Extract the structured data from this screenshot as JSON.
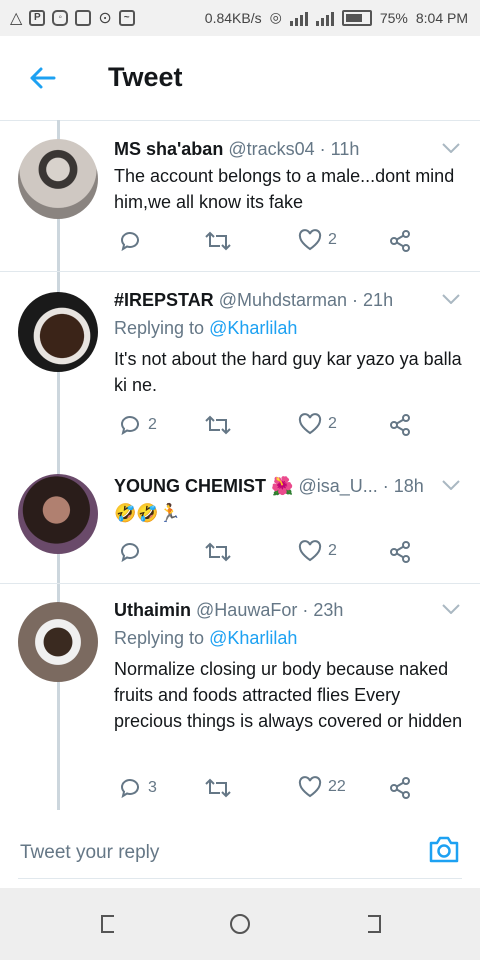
{
  "status_bar": {
    "network_speed": "0.84KB/s",
    "battery": "75%",
    "time": "8:04 PM"
  },
  "header": {
    "title": "Tweet"
  },
  "tweets": [
    {
      "name": "MS sha'aban",
      "handle": "@tracks04",
      "time": "· 11h",
      "replying_to": "",
      "text": "The account belongs to a male...dont mind him,we all know its fake",
      "reply_count": "",
      "like_count": "2"
    },
    {
      "name": "#IREPSTAR",
      "handle": "@Muhdstarman",
      "time": "· 21h",
      "replying_label": "Replying to",
      "replying_to": "@Kharlilah",
      "text": "It's not about the hard guy kar yazo ya balla ki ne.",
      "reply_count": "2",
      "like_count": "2"
    },
    {
      "name": "YOUNG CHEMIST",
      "name_emoji": "🌺",
      "handle": "@isa_U...",
      "time": "· 18h",
      "replying_to": "",
      "text": "🤣🤣🏃",
      "reply_count": "",
      "like_count": "2"
    },
    {
      "name": "Uthaimin",
      "handle": "@HauwaFor",
      "time": "· 23h",
      "replying_label": "Replying to",
      "replying_to": "@Kharlilah",
      "text": "Normalize closing ur body because naked fruits and foods attracted flies Every precious things is always covered or hidden",
      "reply_count": "3",
      "like_count": "22"
    }
  ],
  "reply_box": {
    "placeholder": "Tweet your reply"
  },
  "colors": {
    "accent": "#1da1f2",
    "secondary_text": "#657786",
    "divider": "#e1e8ed"
  }
}
